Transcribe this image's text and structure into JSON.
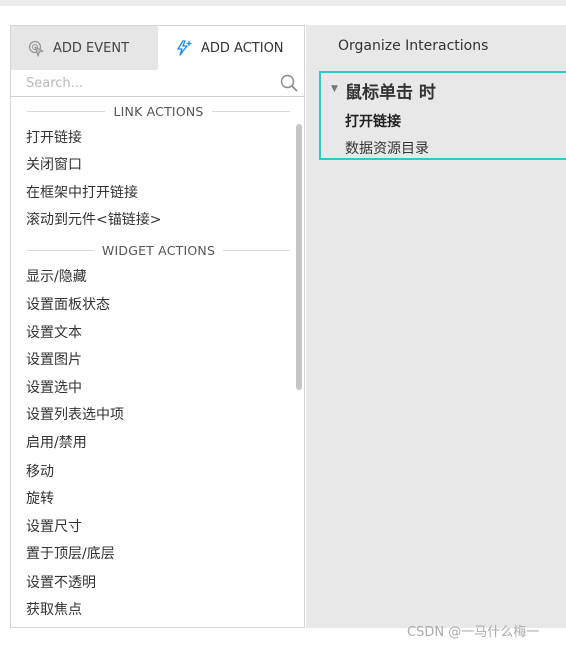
{
  "tabs": {
    "add_event": "ADD EVENT",
    "add_action": "ADD ACTION"
  },
  "search": {
    "placeholder": "Search..."
  },
  "sections": {
    "link_actions": "LINK ACTIONS",
    "widget_actions": "WIDGET ACTIONS"
  },
  "link_actions": [
    "打开链接",
    "关闭窗口",
    "在框架中打开链接",
    "滚动到元件<锚链接>"
  ],
  "widget_actions": [
    "显示/隐藏",
    "设置面板状态",
    "设置文本",
    "设置图片",
    "设置选中",
    "设置列表选中项",
    "启用/禁用",
    "移动",
    "旋转",
    "设置尺寸",
    "置于顶层/底层",
    "设置不透明",
    "获取焦点"
  ],
  "organize": {
    "title": "Organize Interactions",
    "event": "鼠标单击 时",
    "action": "打开链接",
    "target": "数据资源目录"
  },
  "watermark": "CSDN @一马什么梅一",
  "colors": {
    "accent": "#2ec8c8",
    "add_action_icon": "#1e88e5",
    "tab_inactive_bg": "#e6e6e6",
    "panel_bg": "#e8e8e8"
  }
}
